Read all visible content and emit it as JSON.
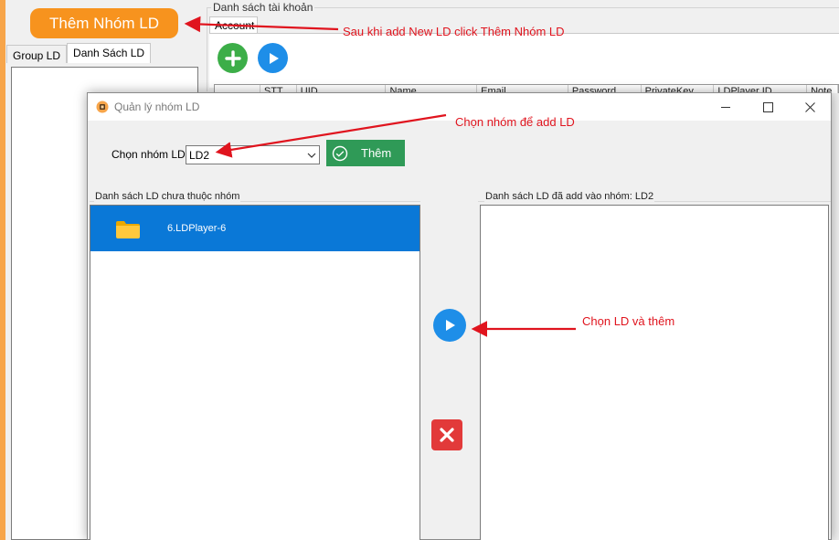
{
  "background_app": {
    "add_group_button": "Thêm Nhóm LD",
    "left_tabs": [
      "Group LD",
      "Danh Sách LD"
    ],
    "account_group_title": "Danh sách tài khoản",
    "account_tab": "Account",
    "grid_columns": [
      "",
      "STT",
      "UID",
      "Name",
      "Email",
      "Password",
      "PrivateKey",
      "LDPlayer ID",
      "Note"
    ]
  },
  "dialog": {
    "title": "Quản lý nhóm LD",
    "select_group_label": "Chọn nhóm LD",
    "select_group_value": "LD2",
    "add_button": "Thêm",
    "left_list_title": "Danh sách LD chưa thuộc nhóm",
    "left_items": [
      "6.LDPlayer-6"
    ],
    "right_list_title": "Danh sách LD đã add vào nhóm: LD2",
    "right_items": []
  },
  "annotations": {
    "note_top": "Sau khi add New LD click Thêm Nhóm LD",
    "note_select": "Chọn nhóm để add LD",
    "note_add": "Chọn LD và thêm"
  },
  "colors": {
    "orange_button": "#f7931e",
    "green_button": "#2f9a57",
    "blue_icon": "#1e8ee8",
    "selection": "#0a78d7",
    "remove_red": "#e23a3a",
    "annotation_red": "#e0141e"
  },
  "icons": [
    "plus-icon",
    "play-icon",
    "check-circle-icon",
    "folder-icon",
    "close-icon",
    "minimize-icon",
    "maximize-icon",
    "chevron-down-icon"
  ]
}
